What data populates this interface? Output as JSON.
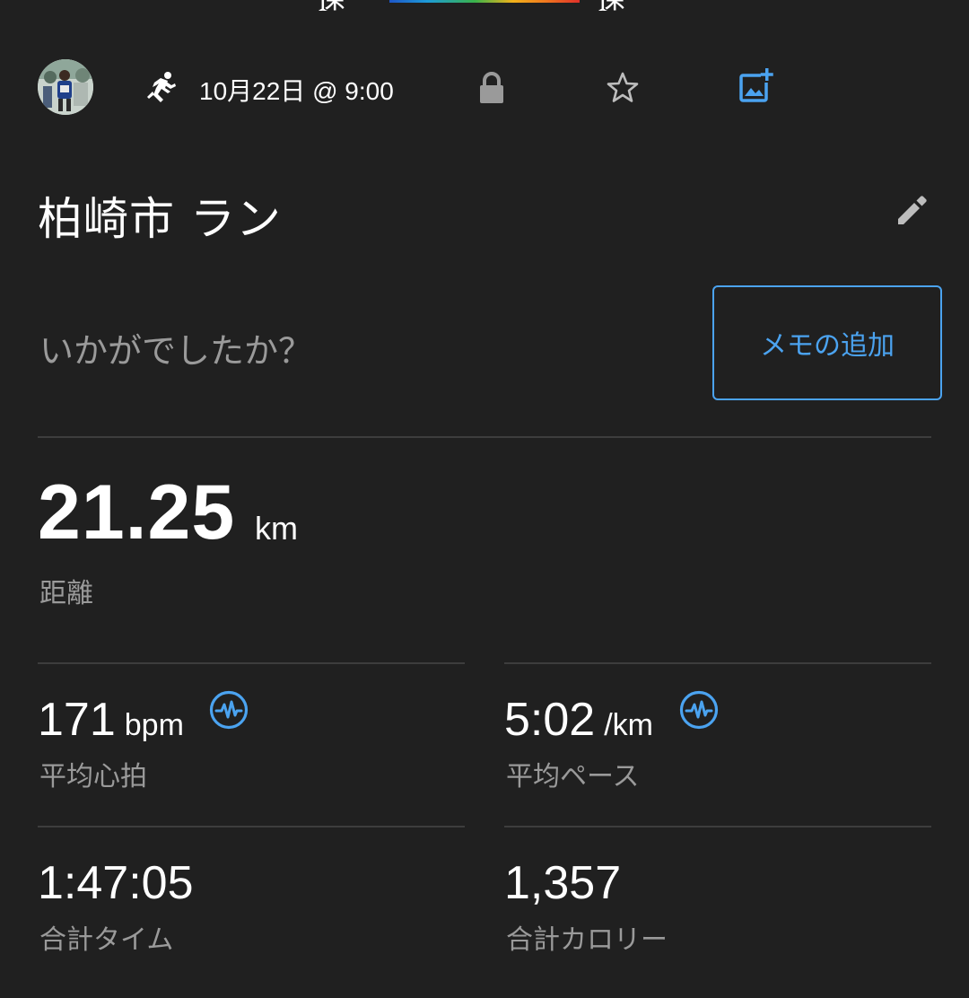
{
  "activity": {
    "date_time": "10月22日 @ 9:00",
    "title": "柏崎市 ラン",
    "type_icon": "running-icon",
    "privacy_icon": "lock-icon",
    "favorite_icon": "star-outline-icon",
    "add_photo_icon": "add-photo-icon"
  },
  "memo": {
    "prompt": "いかがでしたか？",
    "button_label": "メモの追加"
  },
  "distance": {
    "value": "21.25",
    "unit": "km",
    "label": "距離"
  },
  "stats": [
    {
      "value": "171",
      "unit": "bpm",
      "label": "平均心拍",
      "icon": "heart-rate-icon"
    },
    {
      "value": "5:02",
      "unit": "/km",
      "label": "平均ペース",
      "icon": "heart-rate-icon"
    },
    {
      "value": "1:47:05",
      "unit": "",
      "label": "合計タイム"
    },
    {
      "value": "1,357",
      "unit": "",
      "label": "合計カロリー"
    }
  ],
  "colors": {
    "background": "#202020",
    "accent": "#4ba3f0",
    "secondary_text": "#9a9a9a",
    "divider": "#3d3d3d"
  }
}
